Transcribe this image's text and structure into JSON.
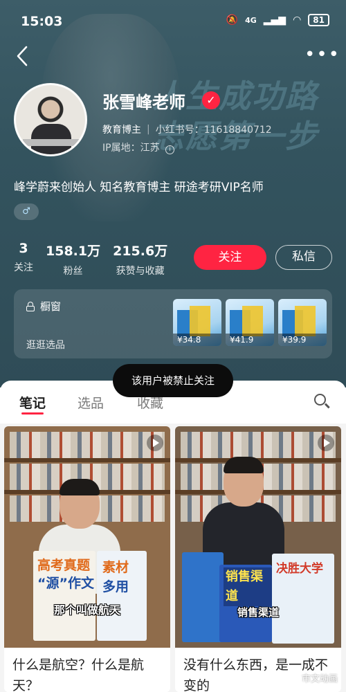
{
  "status_bar": {
    "time": "15:03",
    "network": "4G",
    "battery": "81"
  },
  "profile": {
    "name": "张雪峰老师",
    "verified_mark": "✓",
    "role": "教育博主",
    "rednote_id_label": "小红书号：",
    "rednote_id": "11618840712",
    "ip_label": "IP属地：",
    "ip_location": "江苏",
    "bio": "峰学蔚来创始人 知名教育博主 研途考研VIP名师",
    "gender_symbol": "♂",
    "background_slogan": "人生成功路 志愿第一步"
  },
  "stats": [
    {
      "value": "3",
      "label": "关注"
    },
    {
      "value": "158.1万",
      "label": "粉丝"
    },
    {
      "value": "215.6万",
      "label": "获赞与收藏"
    }
  ],
  "actions": {
    "follow": "关注",
    "message": "私信"
  },
  "shop": {
    "title": "橱窗",
    "subtitle": "逛逛选品",
    "products": [
      {
        "price": "¥34.8"
      },
      {
        "price": "¥41.9"
      },
      {
        "price": "¥39.9"
      }
    ]
  },
  "toast": "该用户被禁止关注",
  "tabs": [
    {
      "label": "笔记",
      "active": true
    },
    {
      "label": "选品",
      "active": false
    },
    {
      "label": "收藏",
      "active": false
    }
  ],
  "notes": [
    {
      "title": "什么是航空？什么是航天？",
      "video_caption": "那个叫做航天",
      "book_text_1": "高考真题",
      "book_text_2": "“源”作文",
      "book_text_3": "素材",
      "book_text_4": "多用"
    },
    {
      "title": "没有什么东西，是一成不变的",
      "video_caption": "销售渠道",
      "sign_text": "销售渠道",
      "book_text_1": "决胜大学"
    }
  ],
  "watermark": "市文动画",
  "colors": {
    "accent": "#ff2442",
    "header_bg": "#33535e"
  }
}
